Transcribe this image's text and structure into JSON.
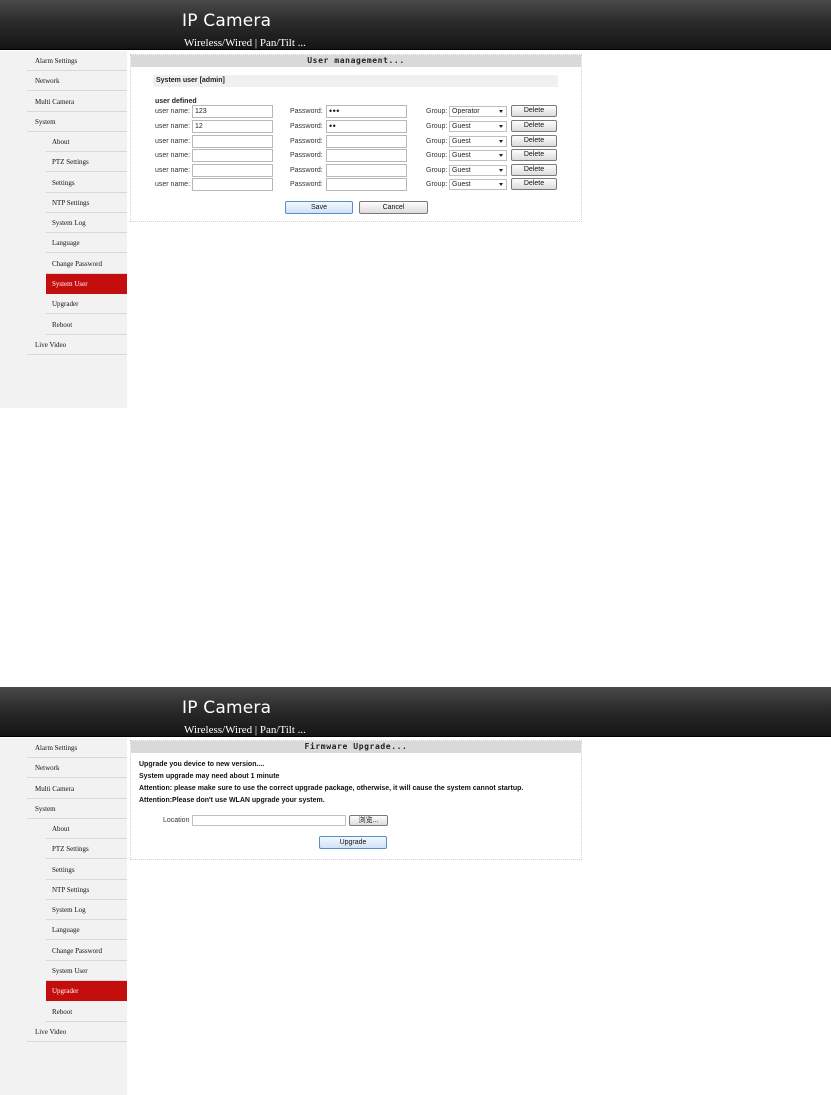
{
  "header": {
    "title": "IP Camera",
    "subtitle": "Wireless/Wired | Pan/Tilt ..."
  },
  "screens": [
    {
      "sidebar": {
        "items": [
          {
            "label": "Alarm Settings"
          },
          {
            "label": "Network"
          },
          {
            "label": "Multi Camera"
          },
          {
            "label": "System"
          },
          {
            "label": "About"
          },
          {
            "label": "PTZ Settings"
          },
          {
            "label": "Settings"
          },
          {
            "label": "NTP Settings"
          },
          {
            "label": "System Log"
          },
          {
            "label": "Language"
          },
          {
            "label": "Change Password"
          },
          {
            "label": "System User",
            "active": true
          },
          {
            "label": "Upgrader"
          },
          {
            "label": "Reboot"
          },
          {
            "label": "Live Video"
          }
        ]
      },
      "panel_title": "User management...",
      "system_user_label": "System user [admin]",
      "user_defined_label": "user defined",
      "username_label": "user name:",
      "password_label": "Password:",
      "group_label": "Group:",
      "delete_label": "Delete",
      "users": [
        {
          "username": "123",
          "password": "•••",
          "group": "Operator"
        },
        {
          "username": "12",
          "password": "••",
          "group": "Guest"
        },
        {
          "username": "",
          "password": "",
          "group": "Guest"
        },
        {
          "username": "",
          "password": "",
          "group": "Guest"
        },
        {
          "username": "",
          "password": "",
          "group": "Guest"
        },
        {
          "username": "",
          "password": "",
          "group": "Guest"
        }
      ],
      "save_label": "Save",
      "cancel_label": "Cancel"
    },
    {
      "sidebar": {
        "items": [
          {
            "label": "Alarm Settings"
          },
          {
            "label": "Network"
          },
          {
            "label": "Multi Camera"
          },
          {
            "label": "System"
          },
          {
            "label": "About"
          },
          {
            "label": "PTZ Settings"
          },
          {
            "label": "Settings"
          },
          {
            "label": "NTP Settings"
          },
          {
            "label": "System Log"
          },
          {
            "label": "Language"
          },
          {
            "label": "Change Password"
          },
          {
            "label": "System User"
          },
          {
            "label": "Upgrader",
            "active": true
          },
          {
            "label": "Reboot"
          },
          {
            "label": "Live Video"
          }
        ]
      },
      "panel_title": "Firmware Upgrade...",
      "lines": [
        "Upgrade you device to new version....",
        "System upgrade may need about 1 minute",
        "Attention: please make sure to use the correct upgrade package, otherwise, it will cause the system cannot startup.",
        "Attention:Please don't use WLAN upgrade your system."
      ],
      "location_label": "Location",
      "browse_label": "浏览...",
      "upgrade_label": "Upgrade"
    }
  ],
  "colors": {
    "active_menu": "#c40d0d",
    "header_dark": "#1a1a1a"
  }
}
